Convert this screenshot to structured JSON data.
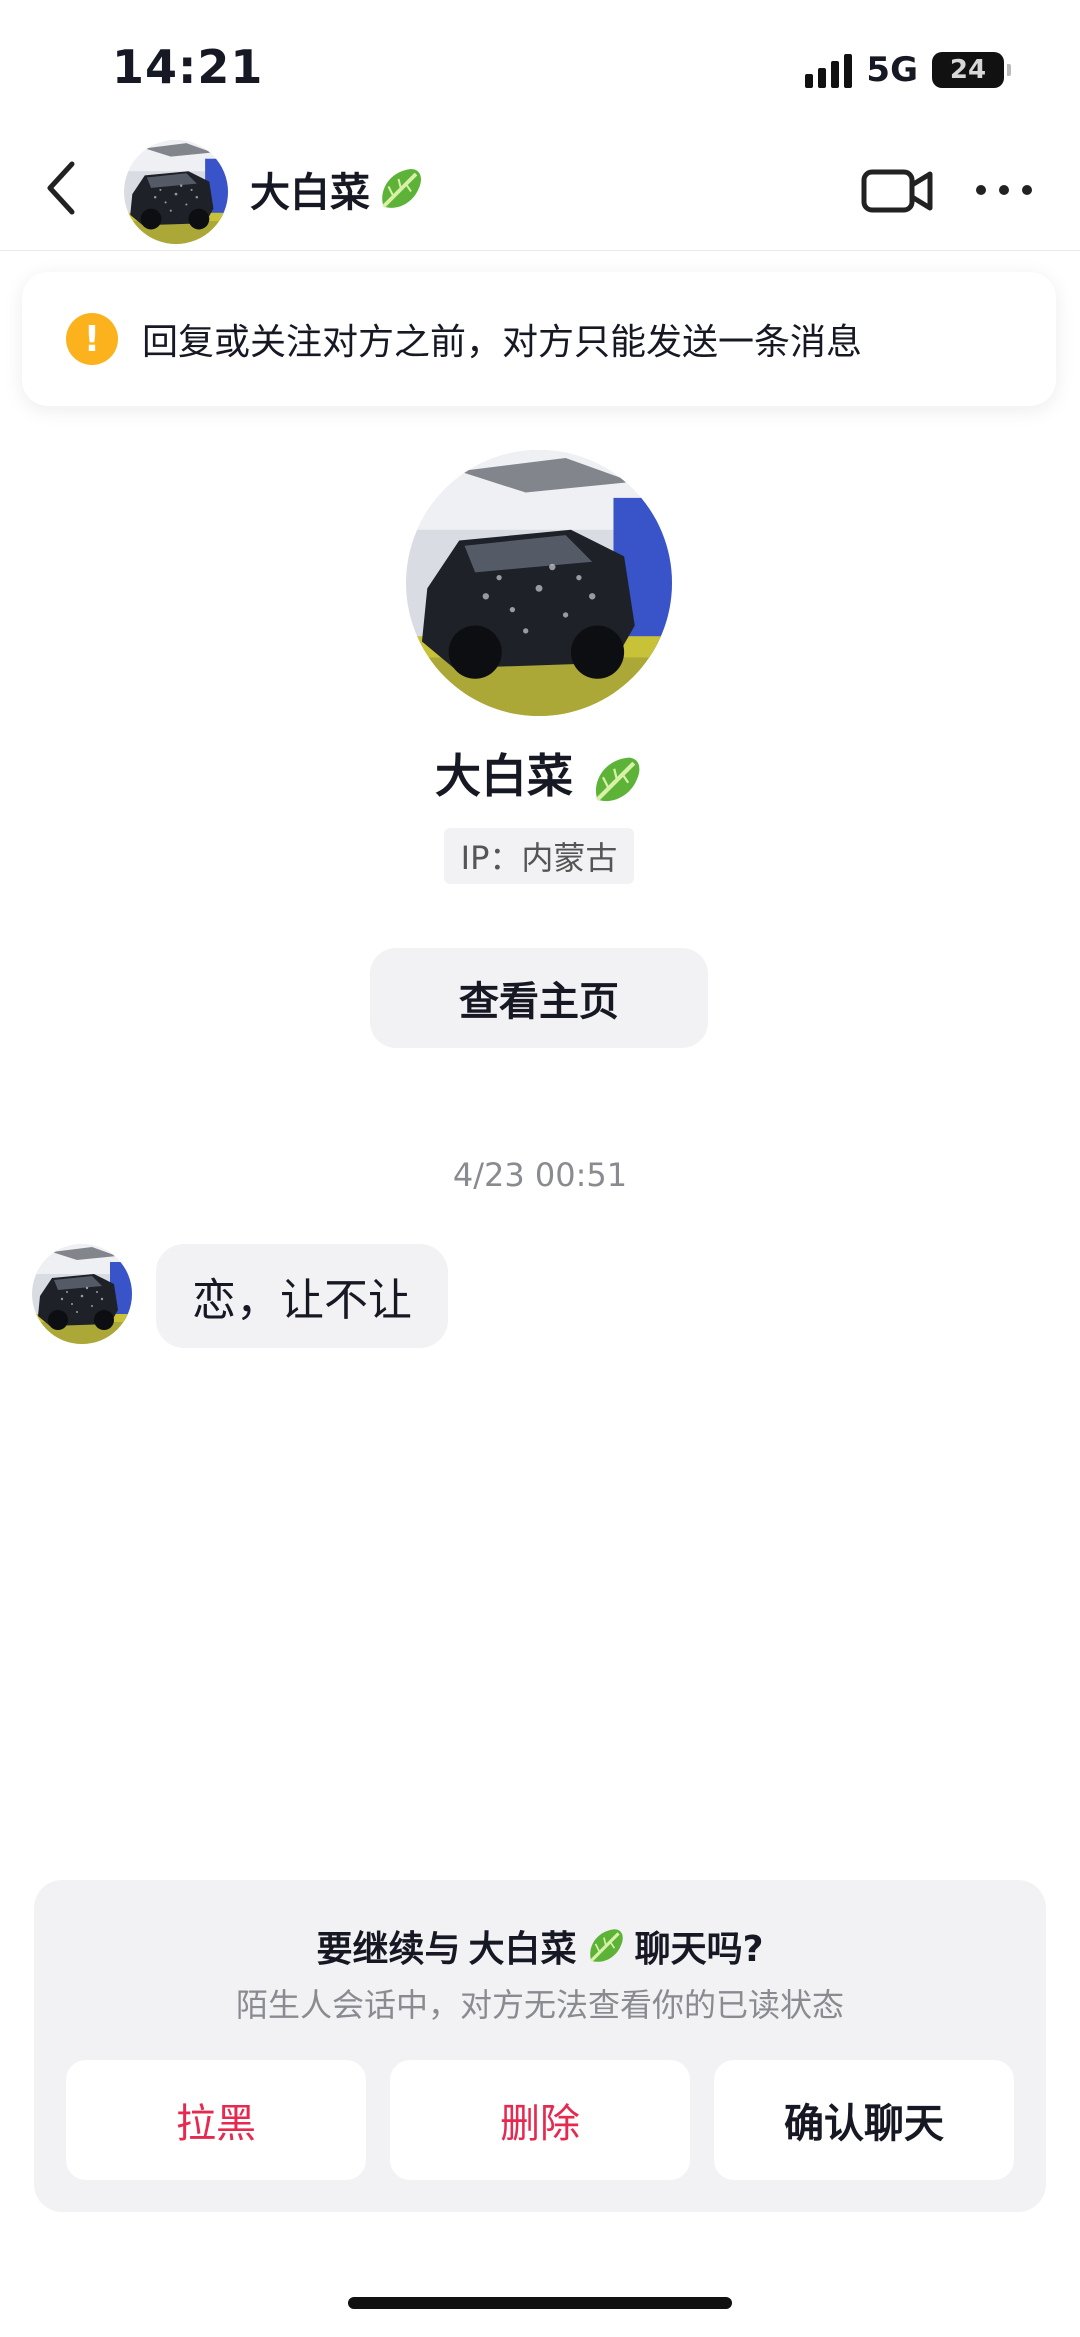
{
  "status_bar": {
    "time": "14:21",
    "network": "5G",
    "battery": "24"
  },
  "header": {
    "contact_name": "大白菜",
    "name_emoji_icon": "cabbage-icon"
  },
  "notice": {
    "text": "回复或关注对方之前，对方只能发送一条消息",
    "icon": "warning-icon",
    "icon_color": "#fbb21d"
  },
  "profile": {
    "name": "大白菜",
    "ip_label": "IP：内蒙古",
    "view_home_label": "查看主页"
  },
  "chat": {
    "timestamp": "4/23 00:51",
    "messages": [
      {
        "from": "contact",
        "text": "恋，让不让"
      }
    ]
  },
  "prompt_panel": {
    "title_prefix": "要继续与",
    "title_name": "大白菜",
    "title_suffix": "聊天吗?",
    "subtitle": "陌生人会话中，对方无法查看你的已读状态",
    "buttons": {
      "block": "拉黑",
      "delete": "删除",
      "confirm": "确认聊天"
    },
    "danger_color": "#e5294f"
  }
}
